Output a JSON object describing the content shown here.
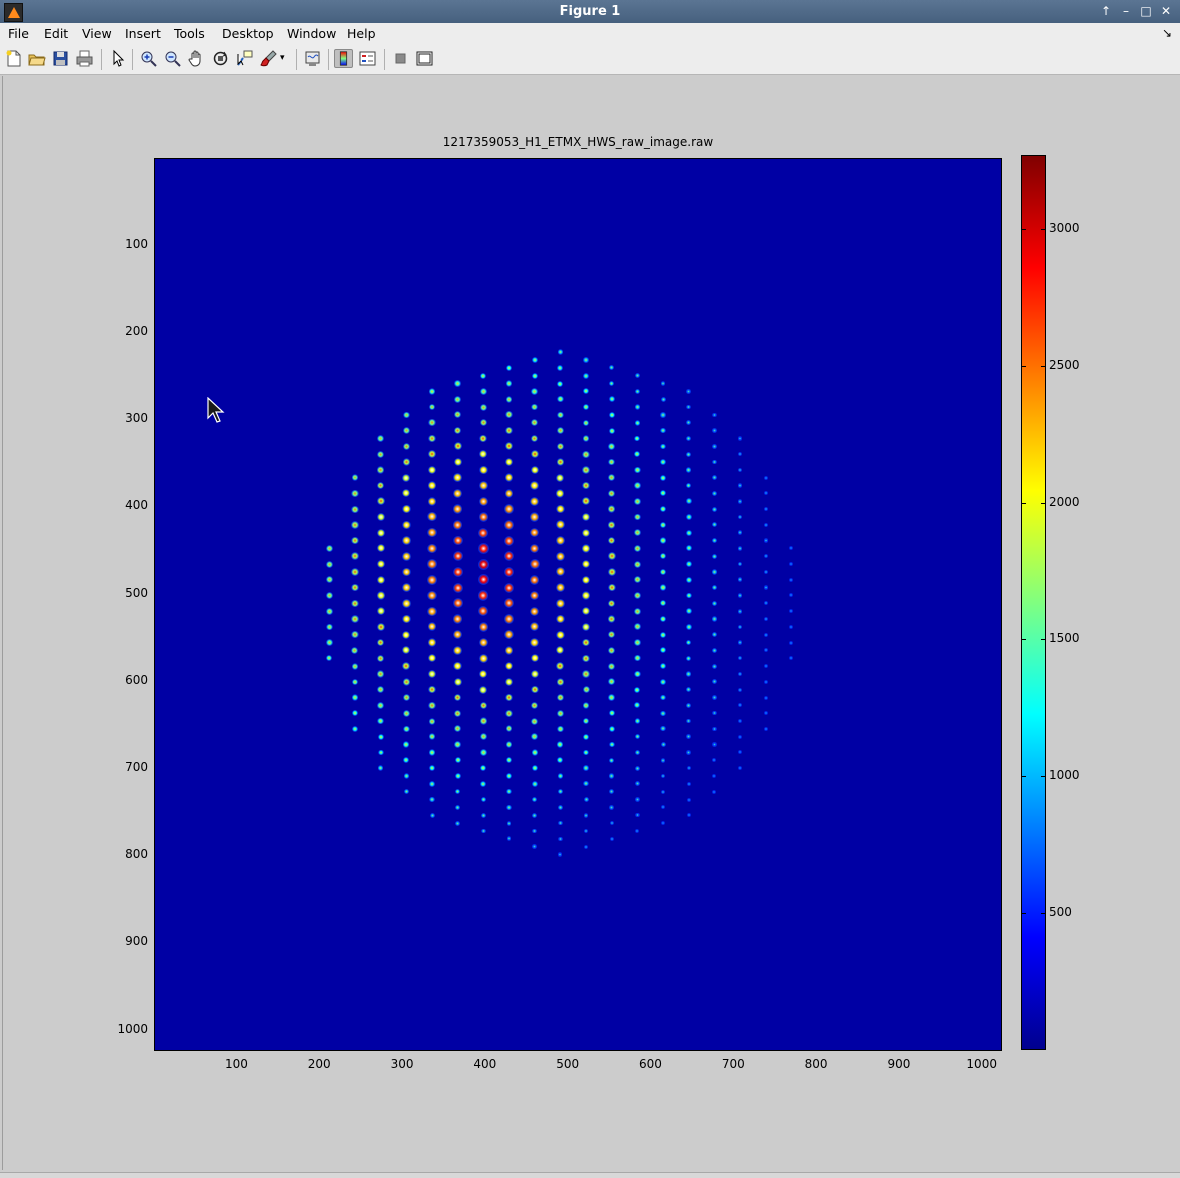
{
  "window": {
    "title": "Figure 1"
  },
  "menubar": {
    "items": [
      {
        "label": "File"
      },
      {
        "label": "Edit"
      },
      {
        "label": "View"
      },
      {
        "label": "Insert"
      },
      {
        "label": "Tools"
      },
      {
        "label": "Desktop"
      },
      {
        "label": "Window"
      },
      {
        "label": "Help"
      }
    ]
  },
  "toolbar": {
    "buttons": [
      "new-figure",
      "open-file",
      "save-figure",
      "print-figure",
      "edit-plot",
      "zoom-in",
      "zoom-out",
      "pan",
      "rotate-3d",
      "data-cursor",
      "brush",
      "link-plot",
      "colorbar",
      "legend",
      "hide-plot-tools",
      "show-plot-tools"
    ]
  },
  "plot": {
    "title": "1217359053_H1_ETMX_HWS_raw_image.raw",
    "yticks": [
      "100",
      "200",
      "300",
      "400",
      "500",
      "600",
      "700",
      "800",
      "900",
      "1000"
    ],
    "xticks": [
      "100",
      "200",
      "300",
      "400",
      "500",
      "600",
      "700",
      "800",
      "900",
      "1000"
    ],
    "colorbar_ticks": [
      "3000",
      "2500",
      "2000",
      "1500",
      "1000",
      "500"
    ]
  },
  "chart_data": {
    "type": "heatmap",
    "title": "1217359053_H1_ETMX_HWS_raw_image.raw",
    "xlim": [
      1,
      1024
    ],
    "ylim": [
      1,
      1024
    ],
    "y_reversed": true,
    "colormap": "jet",
    "clim": [
      0,
      3270
    ],
    "background_value": 0,
    "spot_pattern": {
      "description": "hexagonal grid of bright spots",
      "center": [
        490,
        510
      ],
      "radius": 290,
      "column_spacing": 31,
      "row_spacing": 18,
      "peak_values_range": [
        500,
        3270
      ]
    }
  },
  "colors": {
    "axes_bg": "#0000a4",
    "figure_bg": "#cccccc"
  }
}
